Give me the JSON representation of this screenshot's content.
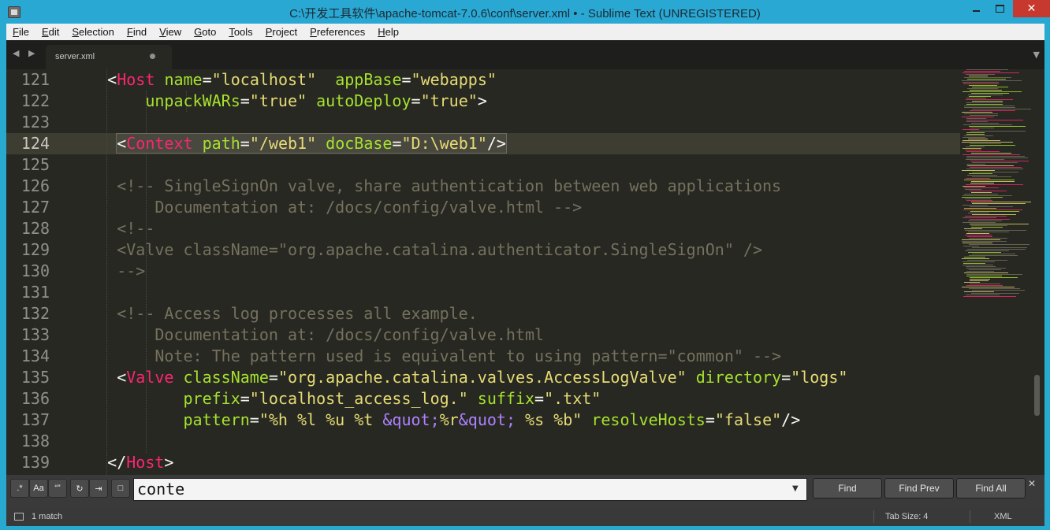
{
  "window": {
    "title": "C:\\开发工具软件\\apache-tomcat-7.0.6\\conf\\server.xml • - Sublime Text (UNREGISTERED)",
    "close_glyph": "✕"
  },
  "menu": [
    "File",
    "Edit",
    "Selection",
    "Find",
    "View",
    "Goto",
    "Tools",
    "Project",
    "Preferences",
    "Help"
  ],
  "tab_bar": {
    "nav_arrows": "◀ ▶",
    "active_tab": "server.xml",
    "menu_arrow": "▼"
  },
  "editor": {
    "current_line": 124,
    "lines": [
      {
        "n": "121",
        "tokens": [
          [
            "p",
            "    <"
          ],
          [
            "t",
            "Host"
          ],
          [
            "p",
            " "
          ],
          [
            "a",
            "name"
          ],
          [
            "p",
            "="
          ],
          [
            "s",
            "\"localhost\""
          ],
          [
            "p",
            "  "
          ],
          [
            "a",
            "appBase"
          ],
          [
            "p",
            "="
          ],
          [
            "s",
            "\"webapps\""
          ]
        ]
      },
      {
        "n": "122",
        "tokens": [
          [
            "p",
            "        "
          ],
          [
            "a",
            "unpackWARs"
          ],
          [
            "p",
            "="
          ],
          [
            "s",
            "\"true\""
          ],
          [
            "p",
            " "
          ],
          [
            "a",
            "autoDeploy"
          ],
          [
            "p",
            "="
          ],
          [
            "s",
            "\"true\""
          ],
          [
            "p",
            ">"
          ]
        ]
      },
      {
        "n": "123",
        "tokens": []
      },
      {
        "n": "124",
        "tokens": [
          [
            "p",
            "     "
          ],
          [
            "hl_open",
            "<"
          ],
          [
            "ht",
            "Context"
          ],
          [
            "hp",
            " "
          ],
          [
            "ha",
            "path"
          ],
          [
            "hp",
            "="
          ],
          [
            "hs",
            "\"/web1\""
          ],
          [
            "hp",
            " "
          ],
          [
            "ha",
            "docBase"
          ],
          [
            "hp",
            "="
          ],
          [
            "hs",
            "\"D:\\web1\""
          ],
          [
            "hp",
            "/>"
          ]
        ]
      },
      {
        "n": "125",
        "tokens": []
      },
      {
        "n": "126",
        "tokens": [
          [
            "c",
            "     <!-- SingleSignOn valve, share authentication between web applications"
          ]
        ]
      },
      {
        "n": "127",
        "tokens": [
          [
            "c",
            "         Documentation at: /docs/config/valve.html -->"
          ]
        ]
      },
      {
        "n": "128",
        "tokens": [
          [
            "c",
            "     <!--"
          ]
        ]
      },
      {
        "n": "129",
        "tokens": [
          [
            "c",
            "     <Valve className=\"org.apache.catalina.authenticator.SingleSignOn\" />"
          ]
        ]
      },
      {
        "n": "130",
        "tokens": [
          [
            "c",
            "     -->"
          ]
        ]
      },
      {
        "n": "131",
        "tokens": []
      },
      {
        "n": "132",
        "tokens": [
          [
            "c",
            "     <!-- Access log processes all example."
          ]
        ]
      },
      {
        "n": "133",
        "tokens": [
          [
            "c",
            "         Documentation at: /docs/config/valve.html"
          ]
        ]
      },
      {
        "n": "134",
        "tokens": [
          [
            "c",
            "         Note: The pattern used is equivalent to using pattern=\"common\" -->"
          ]
        ]
      },
      {
        "n": "135",
        "tokens": [
          [
            "p",
            "     <"
          ],
          [
            "t",
            "Valve"
          ],
          [
            "p",
            " "
          ],
          [
            "a",
            "className"
          ],
          [
            "p",
            "="
          ],
          [
            "s",
            "\"org.apache.catalina.valves.AccessLogValve\""
          ],
          [
            "p",
            " "
          ],
          [
            "a",
            "directory"
          ],
          [
            "p",
            "="
          ],
          [
            "s",
            "\"logs\""
          ]
        ]
      },
      {
        "n": "136",
        "tokens": [
          [
            "p",
            "            "
          ],
          [
            "a",
            "prefix"
          ],
          [
            "p",
            "="
          ],
          [
            "s",
            "\"localhost_access_log.\""
          ],
          [
            "p",
            " "
          ],
          [
            "a",
            "suffix"
          ],
          [
            "p",
            "="
          ],
          [
            "s",
            "\".txt\""
          ]
        ]
      },
      {
        "n": "137",
        "tokens": [
          [
            "p",
            "            "
          ],
          [
            "a",
            "pattern"
          ],
          [
            "p",
            "="
          ],
          [
            "s",
            "\"%h %l %u %t "
          ],
          [
            "e",
            "&quot;"
          ],
          [
            "s",
            "%r"
          ],
          [
            "e",
            "&quot;"
          ],
          [
            "s",
            " %s %b\""
          ],
          [
            "p",
            " "
          ],
          [
            "a",
            "resolveHosts"
          ],
          [
            "p",
            "="
          ],
          [
            "s",
            "\"false\""
          ],
          [
            "p",
            "/>"
          ]
        ]
      },
      {
        "n": "138",
        "tokens": []
      },
      {
        "n": "139",
        "tokens": [
          [
            "p",
            "    </"
          ],
          [
            "t",
            "Host"
          ],
          [
            "p",
            ">"
          ]
        ]
      }
    ]
  },
  "find_panel": {
    "options": [
      ".*",
      "Aa",
      "“”",
      "↻",
      "⇥",
      "□"
    ],
    "query": "conte",
    "dropdown_glyph": "▼",
    "buttons": [
      "Find",
      "Find Prev",
      "Find All"
    ],
    "close_glyph": "✕"
  },
  "status": {
    "matches": "1 match",
    "tab_size": "Tab Size: 4",
    "syntax": "XML"
  }
}
